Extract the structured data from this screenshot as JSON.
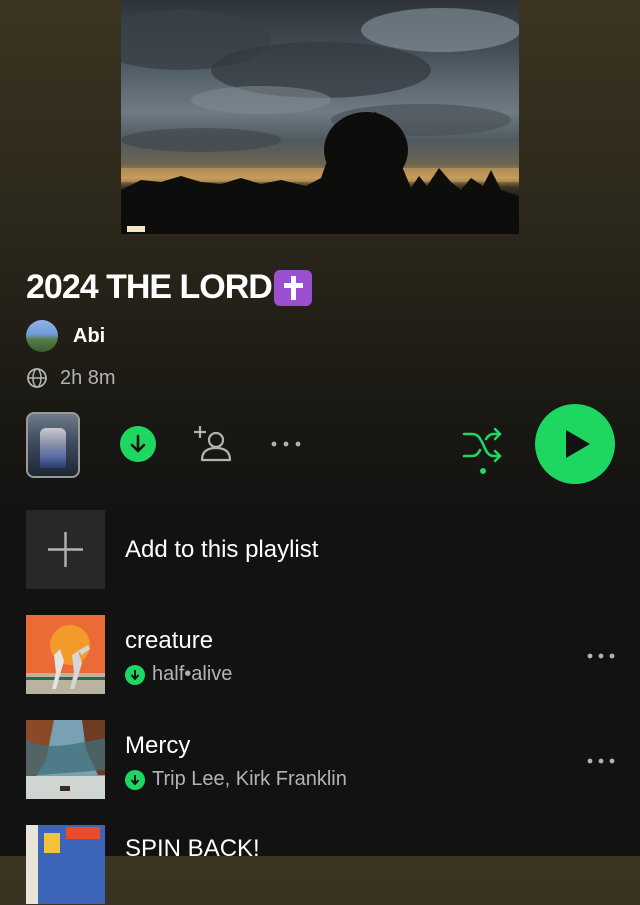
{
  "playlist": {
    "title": "2024 THE LORD",
    "title_emoji": "latin-cross-emoji",
    "owner": "Abi",
    "duration": "2h 8m"
  },
  "actions": {
    "add_to_playlist": "Add to this playlist"
  },
  "tracks": [
    {
      "title": "creature",
      "artist": "half•alive",
      "downloaded": true
    },
    {
      "title": "Mercy",
      "artist": "Trip Lee, Kirk Franklin",
      "downloaded": true
    },
    {
      "title": "SPIN BACK!",
      "artist": "",
      "downloaded": false
    }
  ],
  "colors": {
    "accent": "#1ed760",
    "text_secondary": "#b3b3b3",
    "background": "#121212",
    "emoji_badge": "#9b4fd1"
  },
  "icons": {
    "visibility": "globe-icon",
    "download": "download-arrow-icon",
    "add_collaborator": "add-person-icon",
    "more": "more-horizontal-icon",
    "shuffle": "shuffle-icon",
    "play": "play-icon",
    "add": "plus-icon"
  }
}
